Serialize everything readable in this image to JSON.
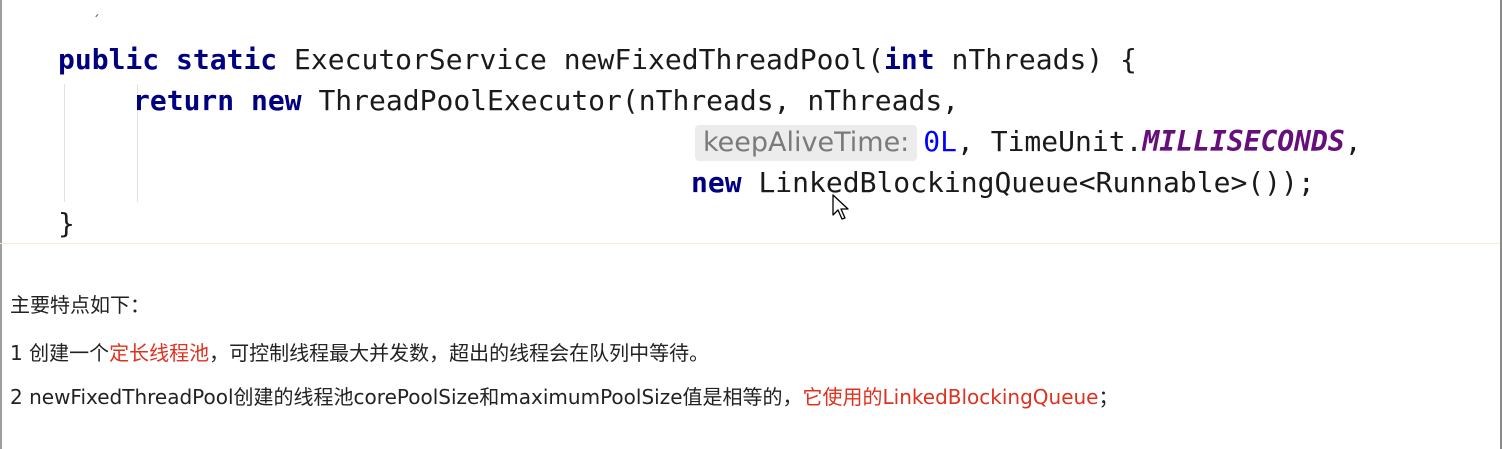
{
  "code": {
    "tick": "´",
    "l1_kw1": "public",
    "l1_kw2": "static",
    "l1_a": "ExecutorService newFixedThreadPool(",
    "l1_kw3": "int",
    "l1_b": "nThreads) {",
    "l2_kw1": "return",
    "l2_kw2": "new",
    "l2_a": "ThreadPoolExecutor(nThreads, nThreads,",
    "l3_hint": "keepAliveTime:",
    "l3_num": "0L",
    "l3_a": ", TimeUnit.",
    "l3_const": "MILLISECONDS",
    "l3_b": ",",
    "l4_kw": "new",
    "l4_a": "LinkedBlockingQueue<Runnable>());",
    "l5": "}"
  },
  "text": {
    "heading": "主要特点如下：",
    "p1_a": "1 创建一个",
    "p1_red": "定长线程池",
    "p1_b": "，可控制线程最大并发数，超出的线程会在队列中等待。",
    "p2_a": "2 newFixedThreadPool创建的线程池corePoolSize和maximumPoolSize值是相等的，",
    "p2_red": "它使用的LinkedBlockingQueue",
    "p2_b": "；"
  },
  "colors": {
    "keyword": "#000080",
    "number": "#0000ff",
    "constant": "#660e7a",
    "highlight": "#e0301e"
  },
  "icons": {
    "cursor": "mouse-pointer-icon"
  }
}
